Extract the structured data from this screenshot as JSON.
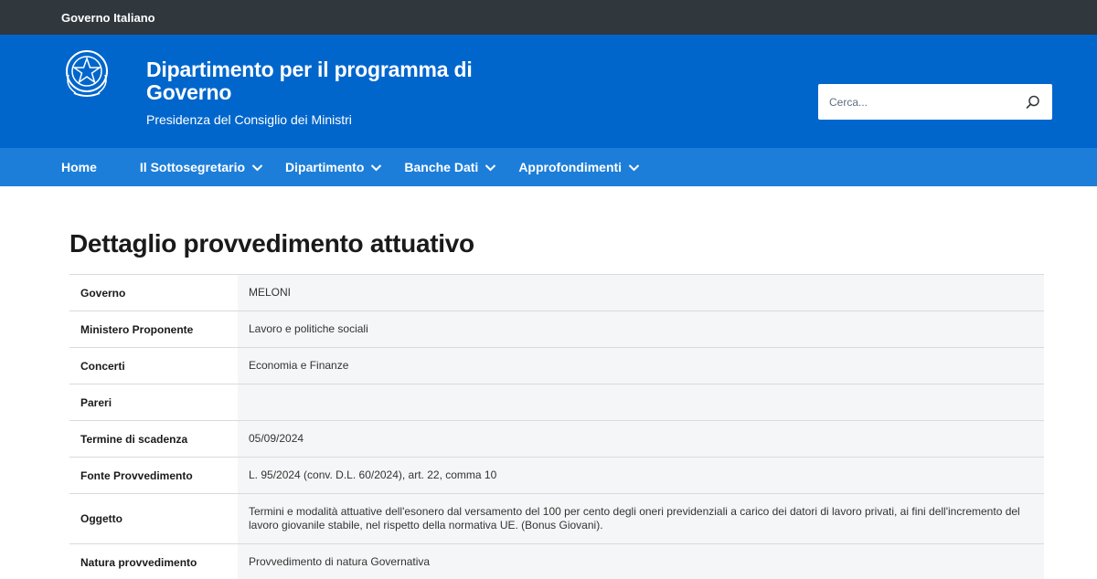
{
  "topbar": {
    "label": "Governo Italiano"
  },
  "header": {
    "title": "Dipartimento per il programma di Governo",
    "subtitle": "Presidenza del Consiglio dei Ministri"
  },
  "search": {
    "placeholder": "Cerca..."
  },
  "nav": {
    "items": [
      {
        "label": "Home",
        "dropdown": false
      },
      {
        "label": "Il Sottosegretario",
        "dropdown": true
      },
      {
        "label": "Dipartimento",
        "dropdown": true
      },
      {
        "label": "Banche Dati",
        "dropdown": true
      },
      {
        "label": "Approfondimenti",
        "dropdown": true
      }
    ]
  },
  "page": {
    "title": "Dettaglio provvedimento attuativo"
  },
  "details": {
    "rows": [
      {
        "label": "Governo",
        "value": "MELONI"
      },
      {
        "label": "Ministero Proponente",
        "value": "Lavoro e politiche sociali"
      },
      {
        "label": "Concerti",
        "value": "Economia e Finanze"
      },
      {
        "label": "Pareri",
        "value": ""
      },
      {
        "label": "Termine di scadenza",
        "value": "05/09/2024"
      },
      {
        "label": "Fonte Provvedimento",
        "value": "L. 95/2024 (conv. D.L. 60/2024), art. 22, comma 10"
      },
      {
        "label": "Oggetto",
        "value": "Termini e modalità attuative dell'esonero dal versamento del 100 per cento degli oneri previdenziali a carico dei datori di lavoro privati, ai fini dell'incremento del lavoro giovanile stabile, nel rispetto della normativa UE. (Bonus Giovani)."
      },
      {
        "label": "Natura provvedimento",
        "value": "Provvedimento di natura Governativa"
      }
    ]
  },
  "colors": {
    "topbar": "#30373d",
    "header": "#0066cc",
    "nav": "#1d7ed9",
    "row_value_bg": "#f5f6f7"
  },
  "icons": {
    "emblem": "italian-republic-emblem-icon",
    "search": "search-icon",
    "dropdown": "chevron-down-icon"
  }
}
